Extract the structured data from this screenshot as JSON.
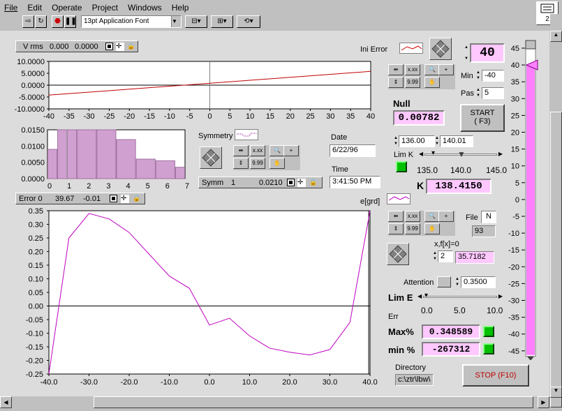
{
  "menu": [
    "File",
    "Edit",
    "Operate",
    "Project",
    "Windows",
    "Help"
  ],
  "toolbar": {
    "font_select": "13pt Application Font",
    "vi_icon_label": "2"
  },
  "top_chart": {
    "legend": {
      "name": "V rms",
      "x": "0.000",
      "y": "0.0000"
    },
    "title": "Ini Error",
    "y_ticks": [
      "10.0000",
      "5.0000",
      "0.0000",
      "-5.0000",
      "-10.0000"
    ],
    "x_ticks": [
      "-40",
      "-35",
      "-30",
      "-25",
      "-20",
      "-15",
      "-10",
      "-5",
      "0",
      "5",
      "10",
      "15",
      "20",
      "25",
      "30",
      "35",
      "40"
    ]
  },
  "hist_chart": {
    "y_ticks": [
      "0.0150",
      "0.0100",
      "0.0050",
      "0.0000"
    ],
    "x_ticks": [
      "0",
      "1",
      "2",
      "3",
      "4",
      "5",
      "6",
      "7"
    ]
  },
  "symmetry": {
    "label": "Symmetry",
    "legend_name": "Symm",
    "legend_x": "1",
    "legend_y": "0.0210"
  },
  "date": {
    "label": "Date",
    "value": "6/22/96"
  },
  "time": {
    "label": "Time",
    "value": "3:41:50 PM"
  },
  "bottom_chart": {
    "legend": {
      "name": "Error 0",
      "x": "39.67",
      "y": "-0.01"
    },
    "title": "e[grd]",
    "y_ticks": [
      "0.35",
      "0.30",
      "0.25",
      "0.20",
      "0.15",
      "0.10",
      "0.05",
      "0.00",
      "-0.05",
      "-0.10",
      "-0.15",
      "-0.20",
      "-0.25"
    ],
    "x_ticks": [
      "-40.0",
      "-30.0",
      "-20.0",
      "-10.0",
      "0.0",
      "10.0",
      "20.0",
      "30.0",
      "40.0"
    ]
  },
  "controls": {
    "big_value": "40",
    "min_label": "Min",
    "min_value": "-40",
    "pas_label": "Pas",
    "pas_value": "5",
    "null_label": "Null",
    "null_value": "0.00782",
    "start_label": "START\n( F3)",
    "range_lo": "136.00",
    "range_hi": "140.01",
    "limk_label": "Lim K",
    "k_slider_ticks": [
      "135.0",
      "140.0",
      "145.0"
    ],
    "k_label": "K",
    "k_value": "138.4150",
    "file_label": "File",
    "file_flag": "N",
    "file_num": "93",
    "root_label": "x,f[x]=0",
    "root_index": "2",
    "root_value": "35.7182",
    "attention_label": "Attention",
    "attention_value": "0.3500",
    "lime_label": "Lim E",
    "lime_ticks": [
      "0.0",
      "5.0",
      "10.0"
    ],
    "err_label": "Err",
    "max_label": "Max%",
    "max_value": "0.348589",
    "min_pct_label": "min %",
    "min_pct_value": "-267312",
    "directory_label": "Directory",
    "directory_value": "c:\\ztr\\lbw\\",
    "stop_label": "STOP  (F10)"
  },
  "vslider": {
    "ticks": [
      "45",
      "40",
      "35",
      "30",
      "25",
      "20",
      "15",
      "10",
      "5",
      "0",
      "-5",
      "-10",
      "-15",
      "-20",
      "-25",
      "-30",
      "-35",
      "-40",
      "-45"
    ],
    "value": 40
  },
  "chart_data": [
    {
      "type": "line",
      "title": "",
      "x": [
        -40,
        40
      ],
      "series": [
        {
          "values": [
            -4.2,
            5.8
          ]
        }
      ],
      "ylim": [
        -10,
        10
      ]
    },
    {
      "type": "bar",
      "categories": [
        "0",
        "1",
        "2",
        "3",
        "4",
        "5",
        "6",
        "7"
      ],
      "values": [
        0.009,
        0.015,
        0.015,
        0.015,
        0.012,
        0.006,
        0.0055,
        0.0035
      ],
      "ylim": [
        0,
        0.015
      ]
    },
    {
      "type": "line",
      "title": "",
      "x": [
        -40,
        -35,
        -30,
        -25,
        -20,
        -15,
        -10,
        -5,
        0,
        5,
        10,
        15,
        20,
        25,
        30,
        35,
        40
      ],
      "series": [
        {
          "values": [
            -0.25,
            0.25,
            0.34,
            0.32,
            0.27,
            0.19,
            0.11,
            0.065,
            -0.07,
            -0.045,
            -0.11,
            -0.155,
            -0.17,
            -0.18,
            -0.16,
            -0.06,
            0.35
          ]
        }
      ],
      "ylim": [
        -0.25,
        0.35
      ]
    }
  ]
}
